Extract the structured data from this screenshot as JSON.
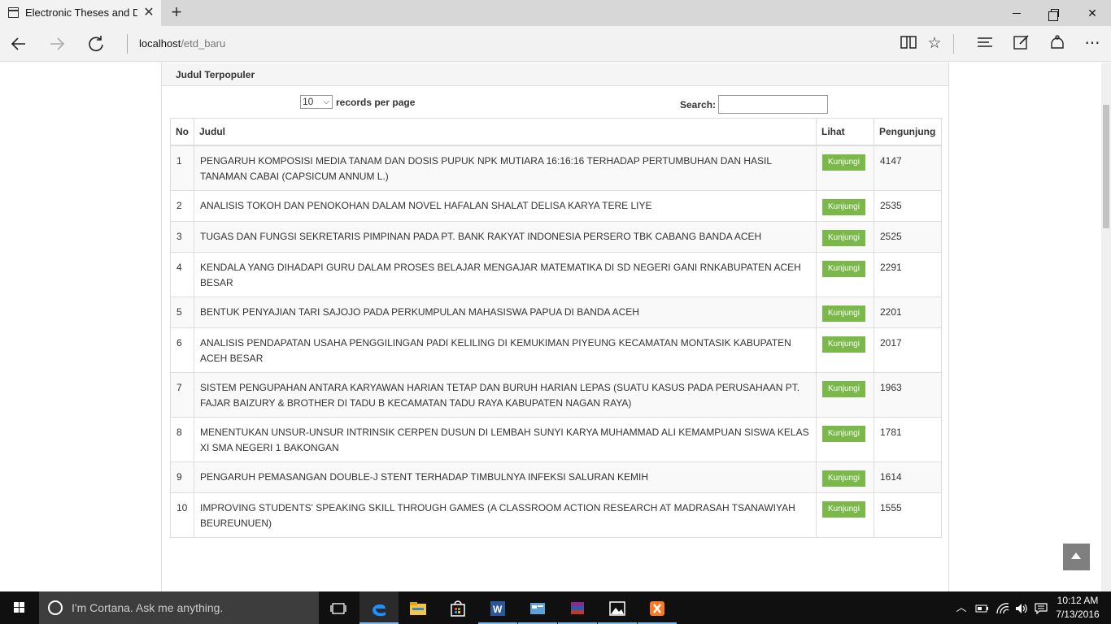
{
  "browser": {
    "tab_title": "Electronic Theses and Di",
    "url_host": "localhost",
    "url_path": "/etd_baru"
  },
  "panel": {
    "heading": "Judul Terpopuler",
    "length_value": "10",
    "length_suffix": "records per page",
    "search_label": "Search:",
    "search_value": ""
  },
  "table": {
    "headers": {
      "no": "No",
      "judul": "Judul",
      "lihat": "Lihat",
      "pengunjung": "Pengunjung"
    },
    "button_label": "Kunjungi",
    "rows": [
      {
        "no": "1",
        "judul": "PENGARUH KOMPOSISI MEDIA TANAM DAN DOSIS PUPUK NPK MUTIARA 16:16:16 TERHADAP PERTUMBUHAN DAN HASIL TANAMAN CABAI (CAPSICUM ANNUM L.)",
        "pengunjung": "4147"
      },
      {
        "no": "2",
        "judul": "ANALISIS TOKOH DAN PENOKOHAN DALAM NOVEL HAFALAN SHALAT DELISA KARYA TERE LIYE",
        "pengunjung": "2535"
      },
      {
        "no": "3",
        "judul": "TUGAS DAN FUNGSI SEKRETARIS PIMPINAN PADA PT. BANK RAKYAT INDONESIA PERSERO TBK CABANG BANDA ACEH",
        "pengunjung": "2525"
      },
      {
        "no": "4",
        "judul": "KENDALA YANG DIHADAPI GURU DALAM PROSES BELAJAR MENGAJAR MATEMATIKA DI SD NEGERI GANI RNKABUPATEN ACEH BESAR",
        "pengunjung": "2291"
      },
      {
        "no": "5",
        "judul": "BENTUK PENYAJIAN TARI SAJOJO PADA PERKUMPULAN MAHASISWA PAPUA DI BANDA ACEH",
        "pengunjung": "2201"
      },
      {
        "no": "6",
        "judul": "ANALISIS PENDAPATAN USAHA PENGGILINGAN PADI KELILING DI KEMUKIMAN PIYEUNG KECAMATAN MONTASIK KABUPATEN ACEH BESAR",
        "pengunjung": "2017"
      },
      {
        "no": "7",
        "judul": "SISTEM PENGUPAHAN ANTARA KARYAWAN HARIAN TETAP DAN BURUH HARIAN LEPAS (SUATU KASUS PADA PERUSAHAAN PT. FAJAR BAIZURY & BROTHER DI TADU B KECAMATAN TADU RAYA KABUPATEN NAGAN RAYA)",
        "pengunjung": "1963"
      },
      {
        "no": "8",
        "judul": "MENENTUKAN UNSUR-UNSUR INTRINSIK CERPEN DUSUN DI LEMBAH SUNYI KARYA MUHAMMAD ALI KEMAMPUAN SISWA KELAS XI SMA NEGERI 1 BAKONGAN",
        "pengunjung": "1781"
      },
      {
        "no": "9",
        "judul": "PENGARUH PEMASANGAN DOUBLE-J STENT TERHADAP TIMBULNYA INFEKSI SALURAN KEMIH",
        "pengunjung": "1614"
      },
      {
        "no": "10",
        "judul": "IMPROVING STUDENTS' SPEAKING SKILL THROUGH GAMES (A CLASSROOM ACTION RESEARCH AT MADRASAH TSANAWIYAH BEUREUNUEN)",
        "pengunjung": "1555"
      }
    ]
  },
  "taskbar": {
    "cortana_text": "I'm Cortana. Ask me anything.",
    "time": "10:12 AM",
    "date": "7/13/2016"
  },
  "colors": {
    "button": "#7bb84a",
    "accent": "#76b9ed"
  }
}
